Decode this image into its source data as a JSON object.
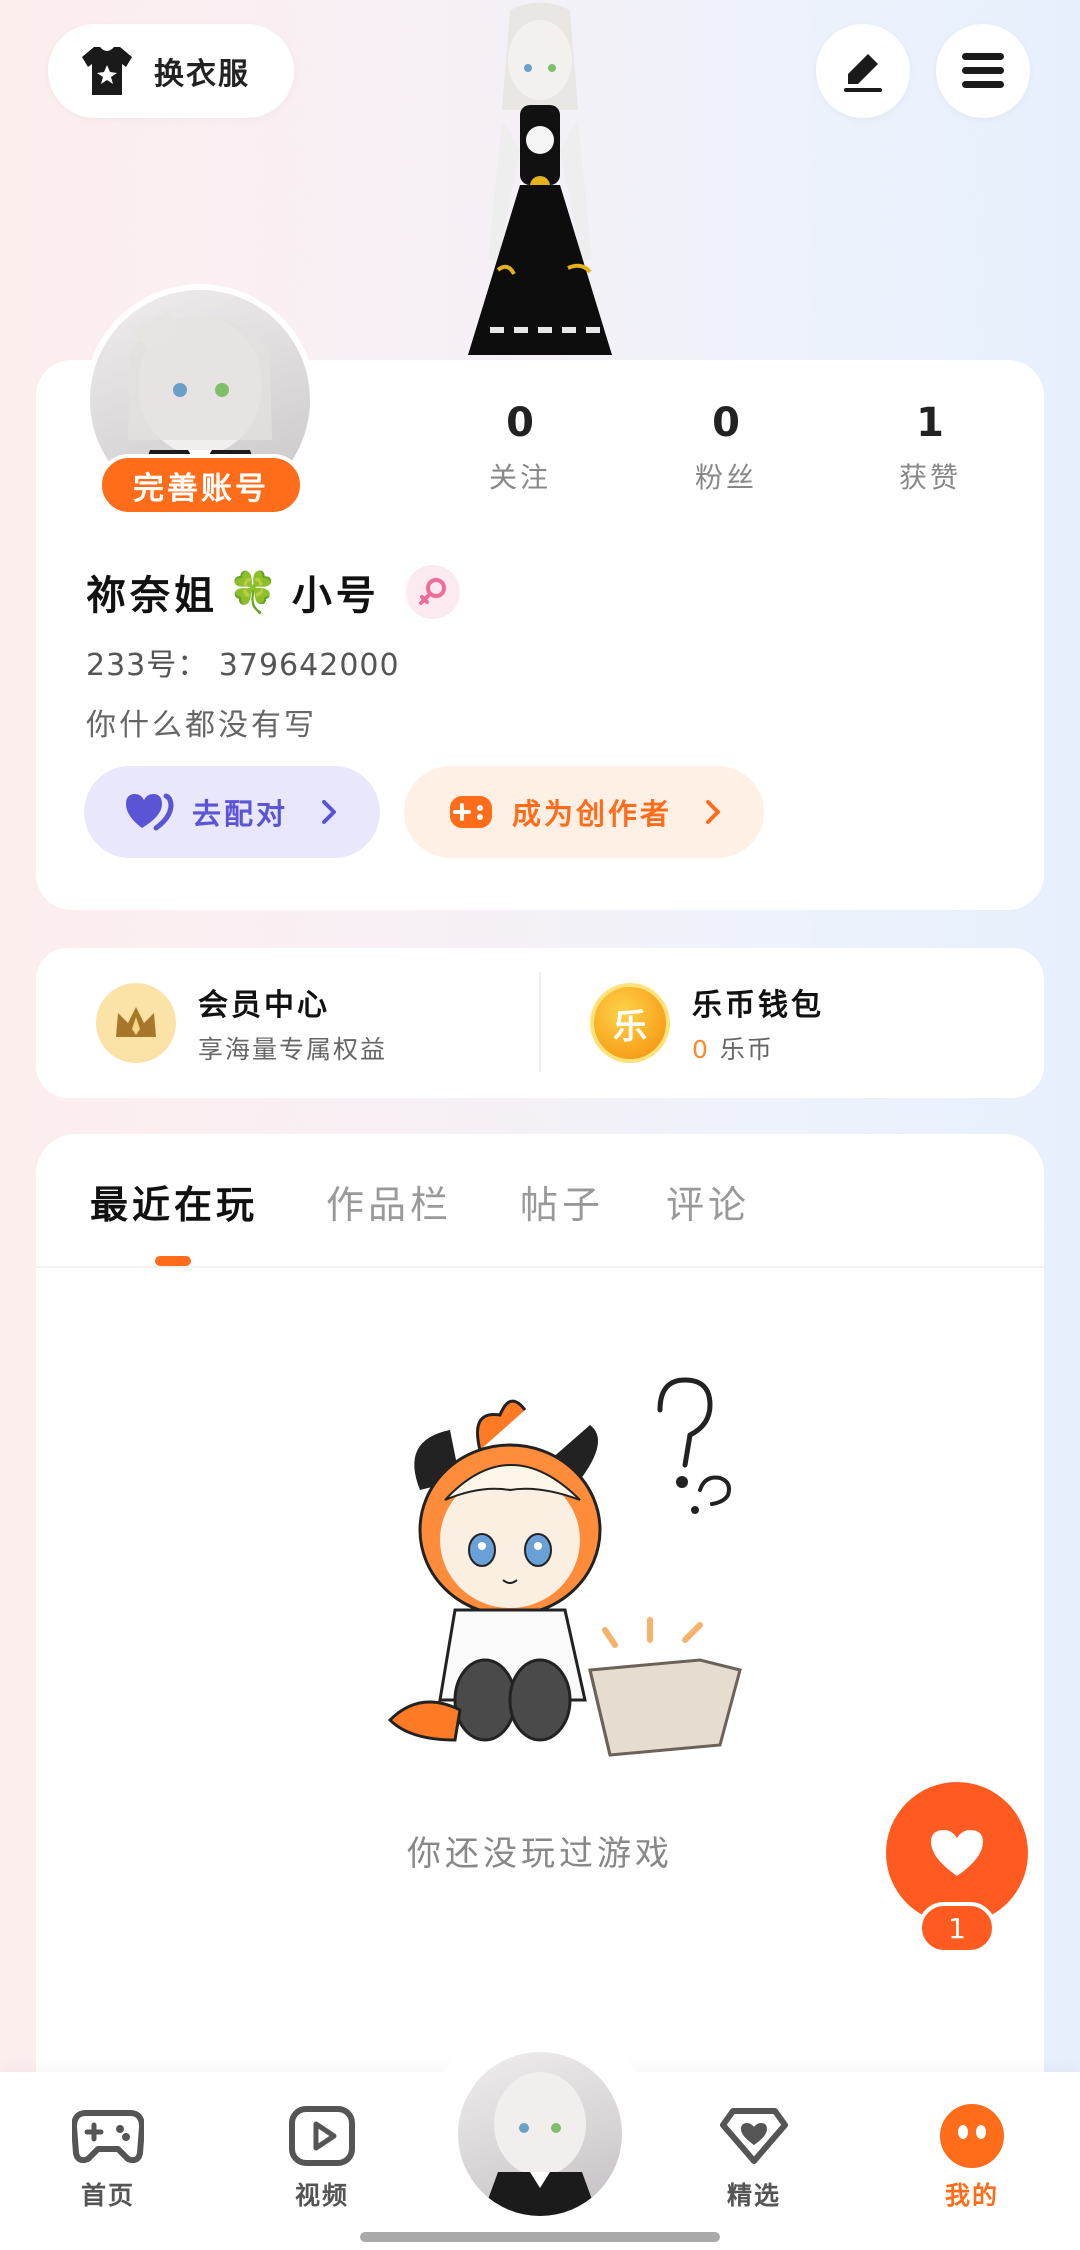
{
  "header": {
    "outfit_label": "换衣服",
    "outfit_icon": "tshirt-icon",
    "edit_icon": "pen-icon",
    "menu_icon": "hamburger-menu-icon"
  },
  "profile": {
    "complete_account_label": "完善账号",
    "stats": [
      {
        "value": "0",
        "label": "关注"
      },
      {
        "value": "0",
        "label": "粉丝"
      },
      {
        "value": "1",
        "label": "获赞"
      }
    ],
    "username": "祢奈姐",
    "username_emoji": "🍀",
    "username_suffix": "小号",
    "gender_icon": "female-icon",
    "uid": "233号： 379642000",
    "bio": "你什么都没有写",
    "pair_label": "去配对",
    "creator_label": "成为创作者"
  },
  "member": {
    "vip_title": "会员中心",
    "vip_sub": "享海量专属权益",
    "wallet_title": "乐币钱包",
    "wallet_amount": "0",
    "wallet_unit": "乐币",
    "coin_glyph": "乐"
  },
  "tabs": [
    "最近在玩",
    "作品栏",
    "帖子",
    "评论"
  ],
  "empty": {
    "text": "你还没玩过游戏"
  },
  "fab": {
    "count": "1"
  },
  "nav": [
    {
      "label": "首页",
      "icon": "gamepad-icon"
    },
    {
      "label": "视频",
      "icon": "play-icon"
    },
    {
      "label": "精选",
      "icon": "heart-diamond-icon"
    },
    {
      "label": "我的",
      "icon": "smiley-icon"
    }
  ],
  "colors": {
    "accent": "#ff6d1a",
    "pair": "#5b55d6",
    "pair_bg": "#e9e7fb",
    "creator_bg": "#fff0e6"
  }
}
